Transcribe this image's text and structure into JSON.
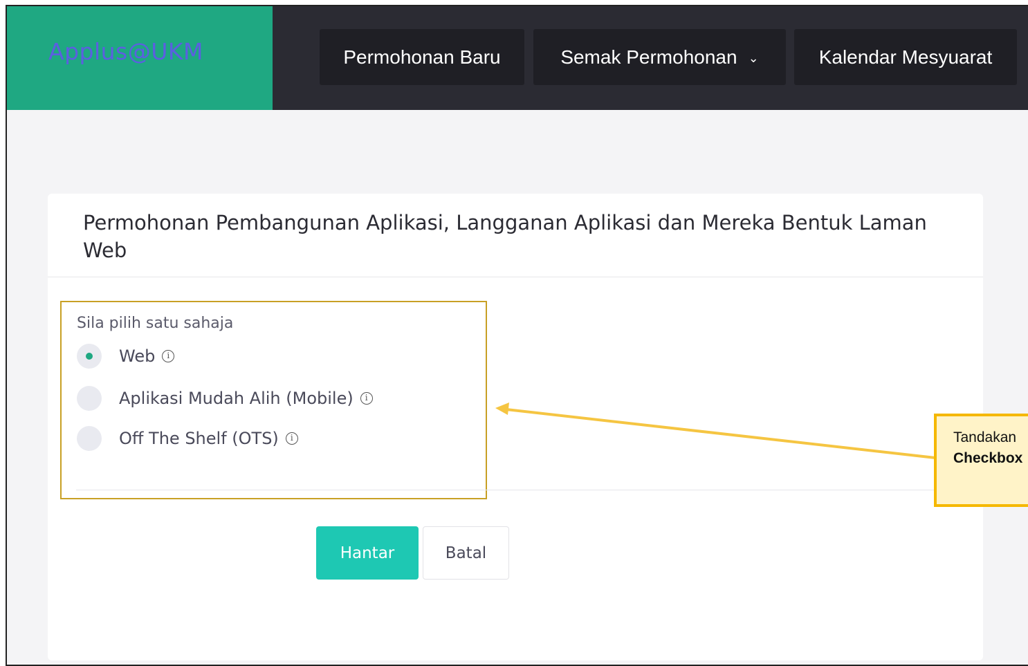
{
  "brand": {
    "name": "Applus@UKM"
  },
  "nav": {
    "items": [
      {
        "label": "Permohonan Baru"
      },
      {
        "label": "Semak Permohonan",
        "has_dropdown": true
      },
      {
        "label": "Kalendar Mesyuarat"
      }
    ]
  },
  "card": {
    "title": "Permohonan Pembangunan Aplikasi, Langganan Aplikasi dan Mereka Bentuk Laman Web",
    "instruction": "Sila pilih satu sahaja",
    "options": [
      {
        "label": "Web",
        "selected": true
      },
      {
        "label": "Aplikasi Mudah Alih (Mobile)",
        "selected": false
      },
      {
        "label": "Off The Shelf (OTS)",
        "selected": false
      }
    ],
    "submit_label": "Hantar",
    "cancel_label": "Batal"
  },
  "callout": {
    "line1": "Tandakan",
    "line2": "Checkbox"
  },
  "colors": {
    "brand_bg": "#1fa882",
    "topbar_bg": "#2b2b33",
    "submit_bg": "#1ec8b3",
    "highlight_border": "#c8a024",
    "callout_border": "#f5b800"
  },
  "icons": {
    "info": "info-icon",
    "dropdown": "chevron-down-icon"
  }
}
